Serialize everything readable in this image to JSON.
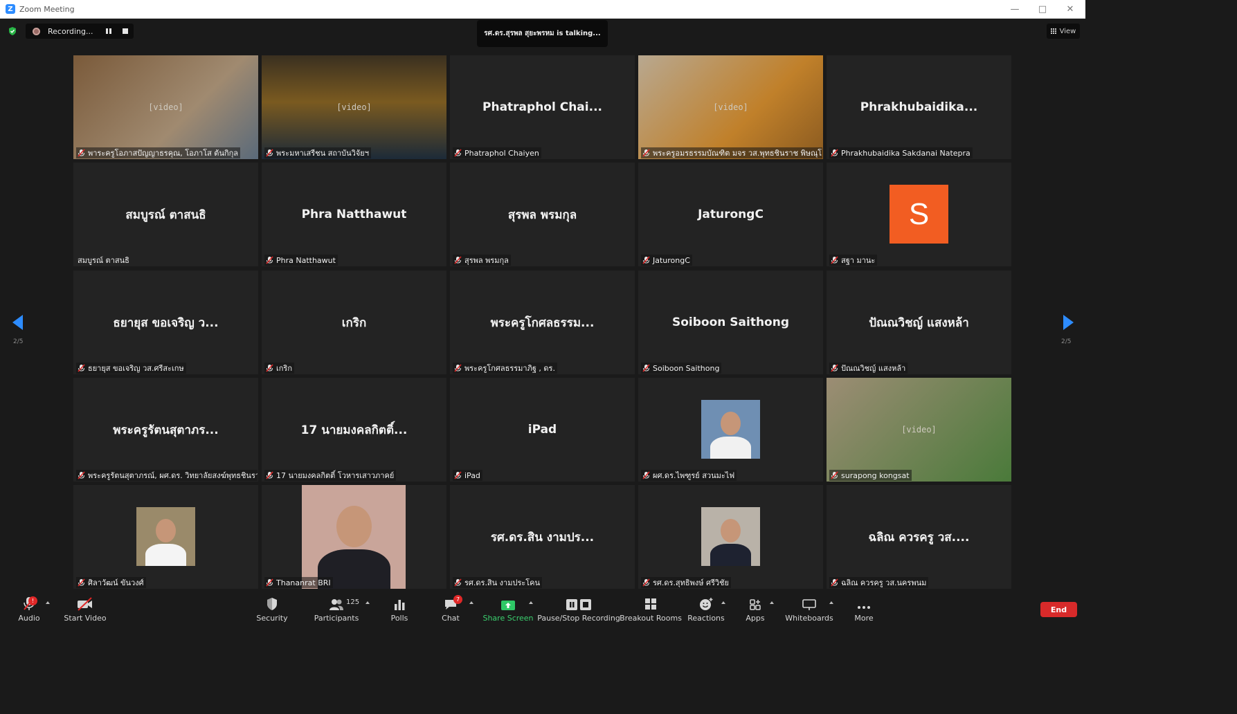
{
  "window": {
    "title": "Zoom Meeting"
  },
  "topbar": {
    "recording_label": "Recording...",
    "talking": "รศ.ดร.สุรพล สุยะพรหม is talking...",
    "view_label": "View"
  },
  "pagination": {
    "left": "2/5",
    "right": "2/5"
  },
  "tiles": [
    {
      "display": "",
      "label": "พาระครูโอภาสปัญญาธรคุณ, โอภาโส ต้นกิกุล",
      "muted": true,
      "type": "video"
    },
    {
      "display": "",
      "label": "พระมหาเสรีชน สถาบันวิจัยฯ",
      "muted": true,
      "type": "video"
    },
    {
      "display": "Phatraphol  Chai...",
      "label": "Phatraphol  Chaiyen",
      "muted": true,
      "type": "name"
    },
    {
      "display": "",
      "label": "พระครูอมรธรรมบัณฑิต มจร วส.พุทธชินราช พิษณุโลก",
      "muted": true,
      "type": "video"
    },
    {
      "display": "Phrakhubaidika...",
      "label": "Phrakhubaidika Sakdanai Natepra",
      "muted": true,
      "type": "name"
    },
    {
      "display": "สมบูรณ์ ตาสนธิ",
      "label": "สมบูรณ์ ตาสนธิ",
      "muted": false,
      "type": "name"
    },
    {
      "display": "Phra Natthawut",
      "label": "Phra Natthawut",
      "muted": true,
      "type": "name"
    },
    {
      "display": "สุรพล พรมกุล",
      "label": "สุรพล พรมกุล",
      "muted": true,
      "type": "name"
    },
    {
      "display": "JaturongC",
      "label": "JaturongC",
      "muted": true,
      "type": "name"
    },
    {
      "display": "S",
      "label": "สฐา มานะ",
      "muted": true,
      "type": "avatar"
    },
    {
      "display": "ธยายุส ขอเจริญ ว...",
      "label": "ธยายุส ขอเจริญ วส.ศรีสะเกษ",
      "muted": true,
      "type": "name"
    },
    {
      "display": "เกริก",
      "label": "เกริก",
      "muted": true,
      "type": "name"
    },
    {
      "display": "พระครูโกศลธรรม...",
      "label": "พระครูโกศลธรรมาภิฐ , ดร.",
      "muted": true,
      "type": "name"
    },
    {
      "display": "Soiboon Saithong",
      "label": "Soiboon Saithong",
      "muted": true,
      "type": "name"
    },
    {
      "display": "ปัณณวิชญ์ แสงหล้า",
      "label": "ปัณณวิชญ์ แสงหล้า",
      "muted": true,
      "type": "name"
    },
    {
      "display": "พระครูรัตนสุตาภร...",
      "label": "พระครูรัตนสุตาภรณ์, ผศ.ดร. วิทยาลัยสงฆ์พุทธชินราช",
      "muted": true,
      "type": "name"
    },
    {
      "display": "17 นายมงคลกิตติ์...",
      "label": "17 นายมงคลกิตติ์ โวหารเสาวภาคย์",
      "muted": true,
      "type": "name"
    },
    {
      "display": "iPad",
      "label": "iPad",
      "muted": true,
      "type": "name"
    },
    {
      "display": "",
      "label": "ผศ.ดร.ไพฑูรย์ สวนมะไฟ",
      "muted": true,
      "type": "photo"
    },
    {
      "display": "",
      "label": "surapong kongsat",
      "muted": true,
      "type": "video"
    },
    {
      "display": "",
      "label": "ศิลาวัฒน์ ขันวงศ์",
      "muted": true,
      "type": "photo"
    },
    {
      "display": "",
      "label": "Thananrat BRI",
      "muted": true,
      "type": "photo"
    },
    {
      "display": "รศ.ดร.สิน  งามปร...",
      "label": "รศ.ดร.สิน  งามประโคน",
      "muted": true,
      "type": "name"
    },
    {
      "display": "",
      "label": "รศ.ดร.สุทธิพงษ์ ศรีวิชัย",
      "muted": true,
      "type": "photo"
    },
    {
      "display": "ฉลิณ ควรครู วส....",
      "label": "ฉลิณ ควรครู วส.นครพนม",
      "muted": true,
      "type": "name"
    }
  ],
  "toolbar": {
    "audio": "Audio",
    "audio_badge": "!",
    "start_video": "Start Video",
    "security": "Security",
    "participants": "Participants",
    "participants_count": "125",
    "polls": "Polls",
    "chat": "Chat",
    "chat_badge": "7",
    "share_screen": "Share Screen",
    "pause_stop_recording": "Pause/Stop Recording",
    "breakout_rooms": "Breakout Rooms",
    "reactions": "Reactions",
    "apps": "Apps",
    "whiteboards": "Whiteboards",
    "more": "More",
    "end": "End"
  },
  "colors": {
    "accent": "#2d8cff",
    "end_red": "#d72a2a",
    "share_green": "#3bd16f",
    "avatar_orange": "#f25d22",
    "tile_bg": "#232323",
    "page_bg": "#1a1a1a"
  }
}
